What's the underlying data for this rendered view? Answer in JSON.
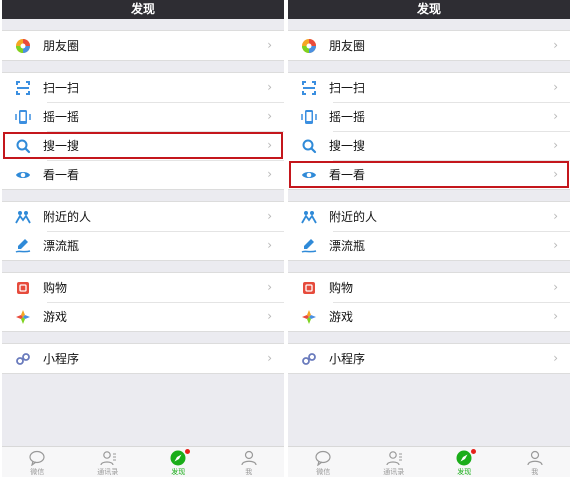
{
  "title": "发现",
  "menu": {
    "moments": "朋友圈",
    "scan": "扫一扫",
    "shake": "摇一摇",
    "search": "搜一搜",
    "look": "看一看",
    "nearby": "附近的人",
    "bottle": "漂流瓶",
    "shopping": "购物",
    "games": "游戏",
    "miniprogram": "小程序"
  },
  "chevron": "›",
  "tabs": {
    "chats": "微信",
    "contacts": "通讯录",
    "discover": "发现",
    "me": "我"
  },
  "colors": {
    "header": "#2e2d33",
    "accent_green": "#1aad19",
    "highlight_box": "#c4161c"
  },
  "highlights": {
    "left_panel": "search",
    "right_panel": "look"
  }
}
